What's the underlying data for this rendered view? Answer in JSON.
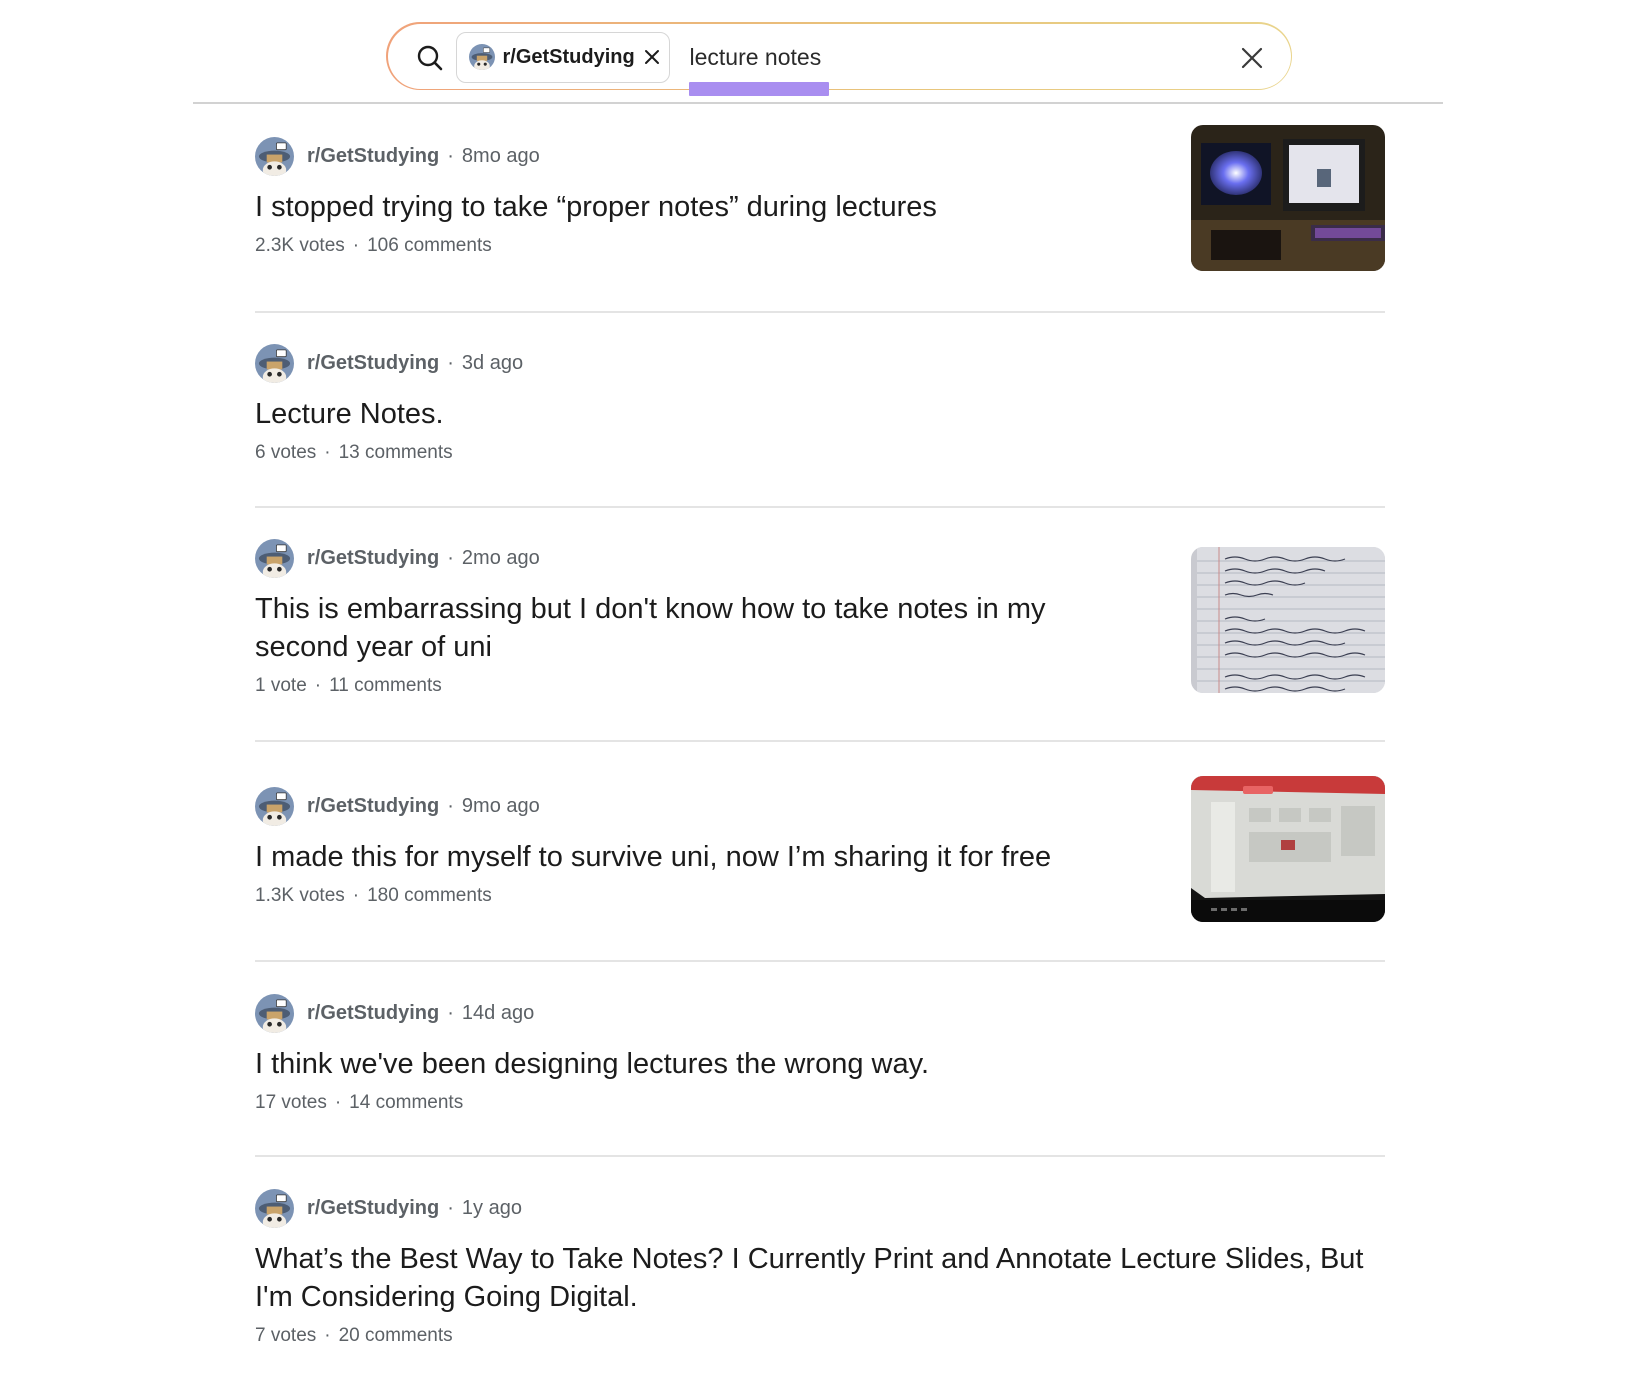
{
  "search": {
    "community_chip": "r/GetStudying",
    "query": "lecture notes"
  },
  "colors": {
    "highlight": "#a98ef0",
    "meta_text": "#5c6166",
    "search_border_start": "#f0a27a",
    "search_border_end": "#e9d48c"
  },
  "posts": [
    {
      "subreddit": "r/GetStudying",
      "age": "8mo ago",
      "title": "I stopped trying to take “proper notes” during lectures",
      "votes": "2.3K votes",
      "comments": "106 comments",
      "thumbnail": "desk-with-laptop-and-monitor"
    },
    {
      "subreddit": "r/GetStudying",
      "age": "3d ago",
      "title": "Lecture Notes.",
      "votes": "6 votes",
      "comments": "13 comments"
    },
    {
      "subreddit": "r/GetStudying",
      "age": "2mo ago",
      "title": "This is embarrassing but I don't know how to take notes in my second year of uni",
      "votes": "1 vote",
      "comments": "11 comments",
      "thumbnail": "handwritten-notes-page"
    },
    {
      "subreddit": "r/GetStudying",
      "age": "9mo ago",
      "title": "I made this for myself to survive uni, now I’m sharing it for free",
      "votes": "1.3K votes",
      "comments": "180 comments",
      "thumbnail": "laptop-screen-web-app"
    },
    {
      "subreddit": "r/GetStudying",
      "age": "14d ago",
      "title": "I think we've been designing lectures the wrong way.",
      "votes": "17 votes",
      "comments": "14 comments"
    },
    {
      "subreddit": "r/GetStudying",
      "age": "1y ago",
      "title": "What’s the Best Way to Take Notes? I Currently Print and Annotate Lecture Slides, But I'm Considering Going Digital.",
      "votes": "7 votes",
      "comments": "20 comments"
    }
  ]
}
